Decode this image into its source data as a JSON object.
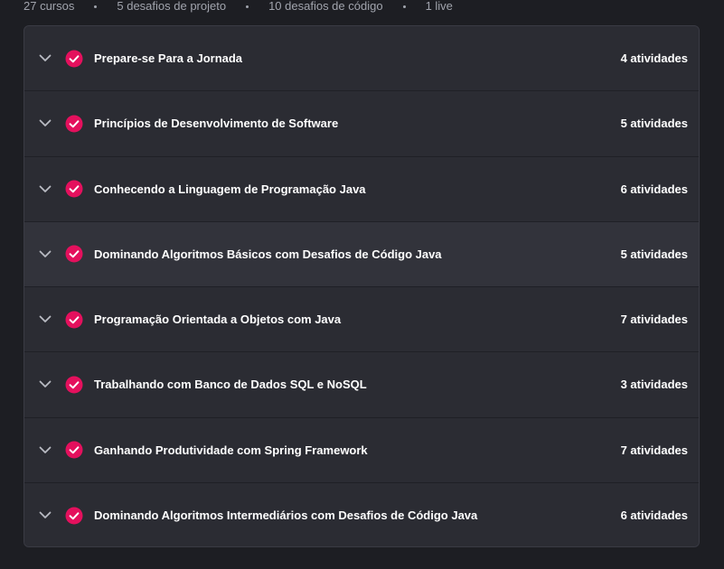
{
  "stats": [
    {
      "label": "27 cursos"
    },
    {
      "label": "5 desafios de projeto"
    },
    {
      "label": "10 desafios de código"
    },
    {
      "label": "1 live"
    }
  ],
  "colors": {
    "accent": "#e4105d",
    "background": "#1d1e23",
    "panel": "#2b2c33",
    "panel_hover": "#32333b",
    "text": "#ffffff",
    "muted": "#a1a4ad"
  },
  "icons": {
    "expand": "chevron-down-icon",
    "status": "check-circle-icon"
  },
  "modules": [
    {
      "title": "Prepare-se Para a Jornada",
      "count": "4 atividades"
    },
    {
      "title": "Princípios de Desenvolvimento de Software",
      "count": "5 atividades"
    },
    {
      "title": "Conhecendo a Linguagem de Programação Java",
      "count": "6 atividades"
    },
    {
      "title": "Dominando Algoritmos Básicos com Desafios de Código Java",
      "count": "5 atividades",
      "hovered": true
    },
    {
      "title": "Programação Orientada a Objetos com Java",
      "count": "7 atividades"
    },
    {
      "title": "Trabalhando com Banco de Dados SQL e NoSQL",
      "count": "3 atividades"
    },
    {
      "title": "Ganhando Produtividade com Spring Framework",
      "count": "7 atividades"
    },
    {
      "title": "Dominando Algoritmos Intermediários com Desafios de Código Java",
      "count": "6 atividades"
    }
  ]
}
